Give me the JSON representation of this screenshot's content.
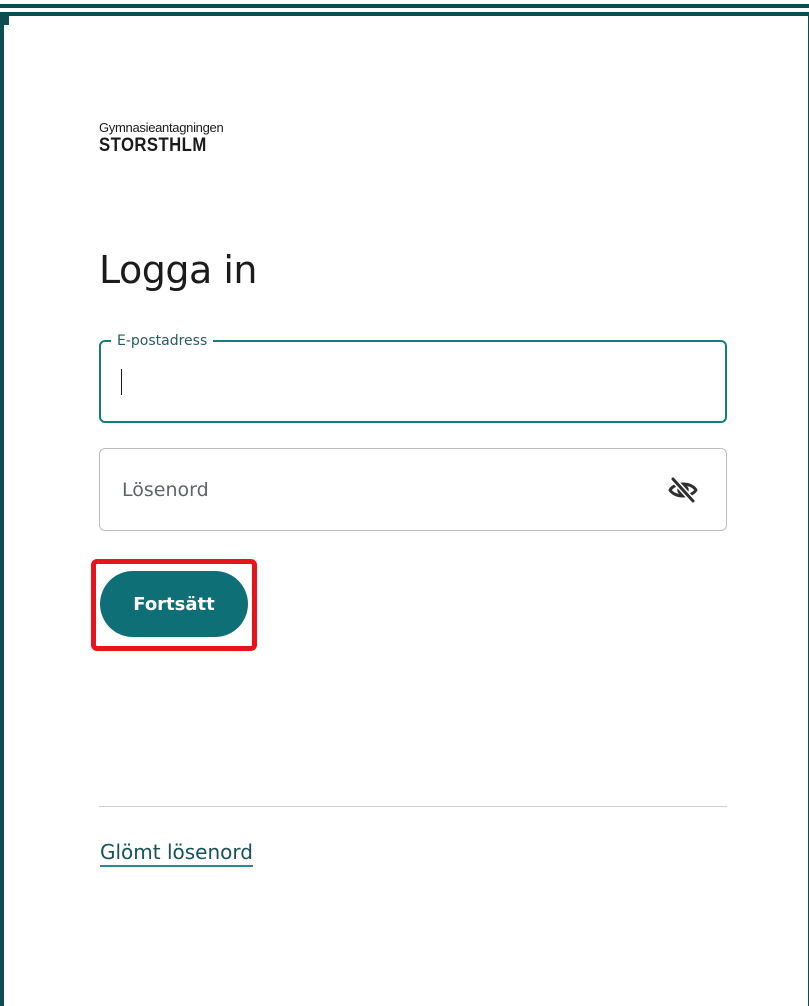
{
  "brand": {
    "subtitle": "Gymnasieantagningen",
    "name": "STORSTHLM"
  },
  "page": {
    "title": "Logga in"
  },
  "email": {
    "label": "E-postadress",
    "value": ""
  },
  "password": {
    "placeholder": "Lösenord",
    "value": "",
    "toggle_icon": "eye-off-icon"
  },
  "actions": {
    "continue_label": "Fortsätt"
  },
  "links": {
    "forgot_password": "Glömt lösenord"
  },
  "colors": {
    "primary": "#0f6f76",
    "focus_border": "#147b80",
    "link": "#17525a",
    "highlight": "#e8141a",
    "frame": "#0d4d52"
  }
}
